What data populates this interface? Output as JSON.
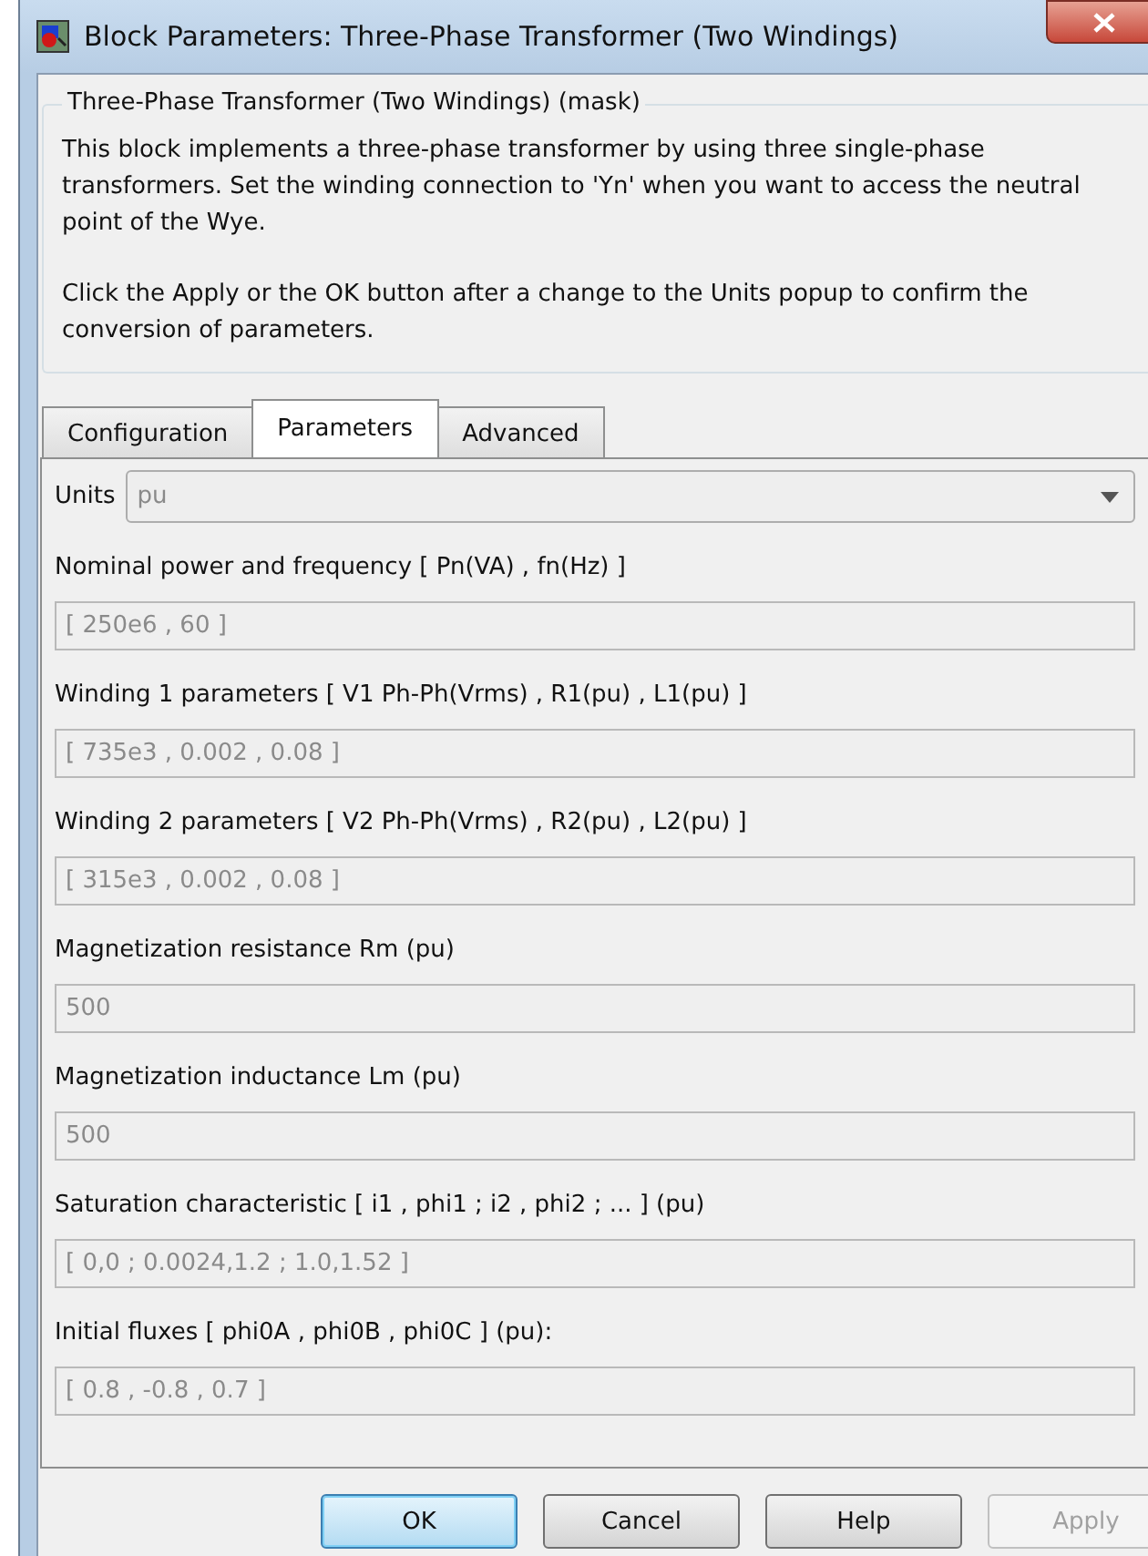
{
  "window": {
    "title": "Block Parameters: Three-Phase Transformer (Two Windings)"
  },
  "group": {
    "title": "Three-Phase Transformer (Two Windings) (mask)",
    "paragraphs": [
      "This block implements a three-phase transformer by using three single-phase transformers. Set the winding connection to 'Yn'  when you want to access the neutral point of the Wye.",
      "Click the Apply or the OK button after a change to the Units popup to confirm the conversion of parameters."
    ]
  },
  "tabs": [
    {
      "label": "Configuration",
      "selected": false
    },
    {
      "label": "Parameters",
      "selected": true
    },
    {
      "label": "Advanced",
      "selected": false
    }
  ],
  "units": {
    "label": "Units",
    "value": "pu",
    "disabled": true
  },
  "parameters": [
    {
      "label": "Nominal power and frequency  [ Pn(VA) , fn(Hz) ]",
      "value": "[ 250e6 , 60 ]",
      "disabled": true
    },
    {
      "label": "Winding 1 parameters [ V1 Ph-Ph(Vrms) , R1(pu) , L1(pu) ]",
      "value": "[ 735e3 , 0.002 , 0.08 ]",
      "disabled": true
    },
    {
      "label": "Winding 2 parameters [ V2 Ph-Ph(Vrms) , R2(pu) , L2(pu) ]",
      "value": "[ 315e3 , 0.002 , 0.08 ]",
      "disabled": true
    },
    {
      "label": "Magnetization resistance  Rm (pu)",
      "value": "500",
      "disabled": true
    },
    {
      "label": "Magnetization inductance  Lm (pu)",
      "value": "500",
      "disabled": true
    },
    {
      "label": "Saturation characteristic [ i1 ,  phi1 ;  i2 , phi2 ; ... ] (pu)",
      "value": "[ 0,0 ; 0.0024,1.2 ; 1.0,1.52 ]",
      "disabled": true
    },
    {
      "label": "Initial fluxes [ phi0A , phi0B , phi0C ] (pu):",
      "value": "[ 0.8 , -0.8 , 0.7 ]",
      "disabled": true
    }
  ],
  "buttons": [
    {
      "label": "OK",
      "default": true,
      "disabled": false
    },
    {
      "label": "Cancel",
      "default": false,
      "disabled": false
    },
    {
      "label": "Help",
      "default": false,
      "disabled": false
    },
    {
      "label": "Apply",
      "default": false,
      "disabled": true
    }
  ]
}
